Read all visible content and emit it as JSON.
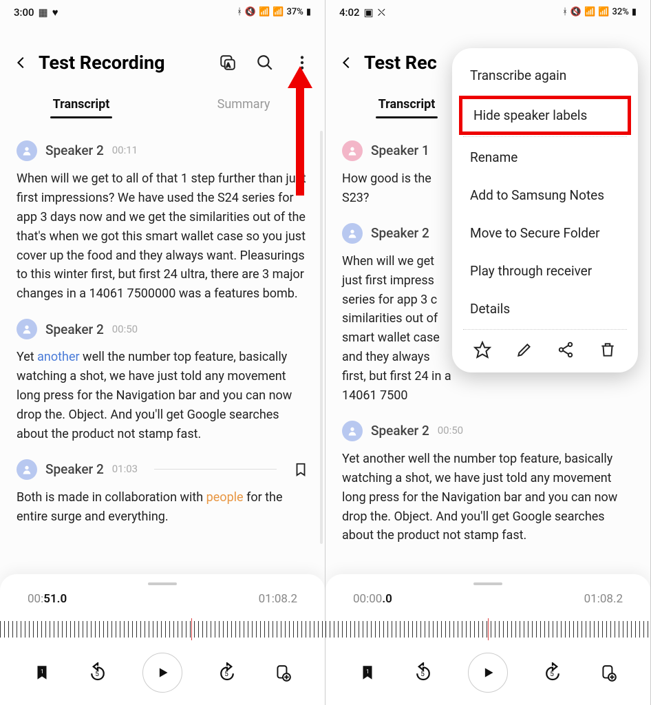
{
  "left": {
    "status": {
      "time": "3:00",
      "battery": "37%"
    },
    "title": "Test Recording",
    "tabs": {
      "transcript": "Transcript",
      "summary": "Summary"
    },
    "entries": [
      {
        "speaker": "Speaker 2",
        "time": "00:11",
        "avatar": "blue",
        "text_plain": "When will we get to all of that 1 step further than just first impressions? We have used the S24 series for app 3 days now and we get the similarities out of the that's when we got this smart wallet case so you just cover up the food and they always want. Pleasurings to this winter first, but first 24 ultra, there are 3 major changes in a 14061 7500000 was a features bomb."
      },
      {
        "speaker": "Speaker 2",
        "time": "00:50",
        "avatar": "blue",
        "pre": "Yet ",
        "hl": "another",
        "post": " well the number top feature, basically watching a shot, we have just told any movement long press for the Navigation bar and you can now drop the. Object. And you'll get Google searches about the product not stamp fast."
      },
      {
        "speaker": "Speaker 2",
        "time": "01:03",
        "avatar": "blue",
        "bookmarked": true,
        "pre": "Both is made in collaboration with ",
        "hl": "people",
        "post": " for the entire surge and everything."
      }
    ],
    "player": {
      "current_pre": "00:",
      "current_bold": "51.0",
      "total": "01:08.2"
    }
  },
  "right": {
    "status": {
      "time": "4:02",
      "battery": "32%"
    },
    "title": "Test Rec",
    "tabs": {
      "transcript": "Transcript"
    },
    "entries": [
      {
        "speaker": "Speaker 1",
        "time": "",
        "avatar": "pink",
        "text_plain": "How good is the S23?"
      },
      {
        "speaker": "Speaker 2",
        "time": "",
        "avatar": "blue",
        "text_plain": "When will we get just first impress series for app 3 c similarities out of smart wallet case and they always first, but first 24 in a 14061 7500"
      },
      {
        "speaker": "Speaker 2",
        "time": "00:50",
        "avatar": "blue",
        "text_plain": "Yet another well the number top feature, basically watching a shot, we have just told any movement long press for the Navigation bar and you can now drop the. Object. And you'll get Google searches about the product not stamp fast."
      }
    ],
    "menu": {
      "items": [
        "Transcribe again",
        "Hide speaker labels",
        "Rename",
        "Add to Samsung Notes",
        "Move to Secure Folder",
        "Play through receiver",
        "Details"
      ]
    },
    "player": {
      "current_pre": "00:00",
      "current_bold": ".0",
      "total": "01:08.2"
    }
  }
}
